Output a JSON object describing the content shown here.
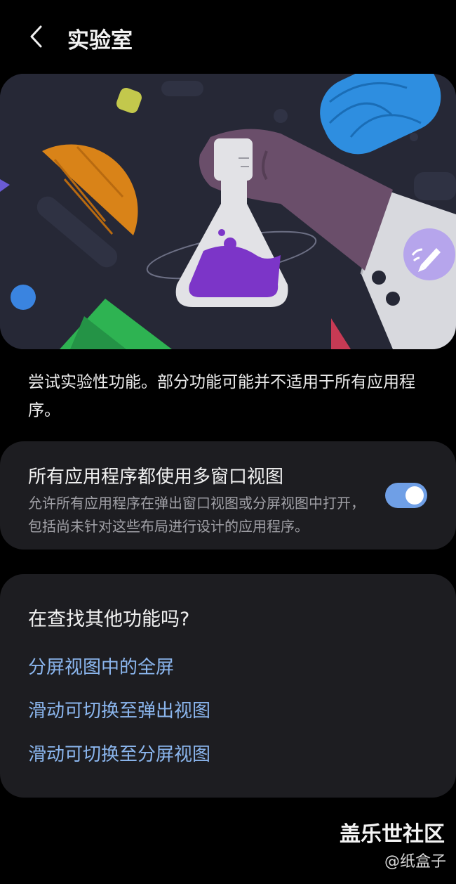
{
  "header": {
    "title": "实验室",
    "back_icon": "chevron-left-icon"
  },
  "intro": "尝试实验性功能。部分功能可能并不适用于所有应用程序。",
  "multi_window": {
    "title": "所有应用程序都使用多窗口视图",
    "description": "允许所有应用程序在弹出窗口视图或分屏视图中打开，包括尚未针对这些布局进行设计的应用程序。",
    "enabled": true
  },
  "more": {
    "title": "在查找其他功能吗?",
    "links": [
      "分屏视图中的全屏",
      "滑动可切换至弹出视图",
      "滑动可切换至分屏视图"
    ]
  },
  "watermark": {
    "line1": "盖乐世社区",
    "line2": "@纸盒子"
  },
  "colors": {
    "accent": "#6f9fe6",
    "link": "#8bb6ee",
    "card": "#1d1d21",
    "banner_bg": "#262836"
  }
}
